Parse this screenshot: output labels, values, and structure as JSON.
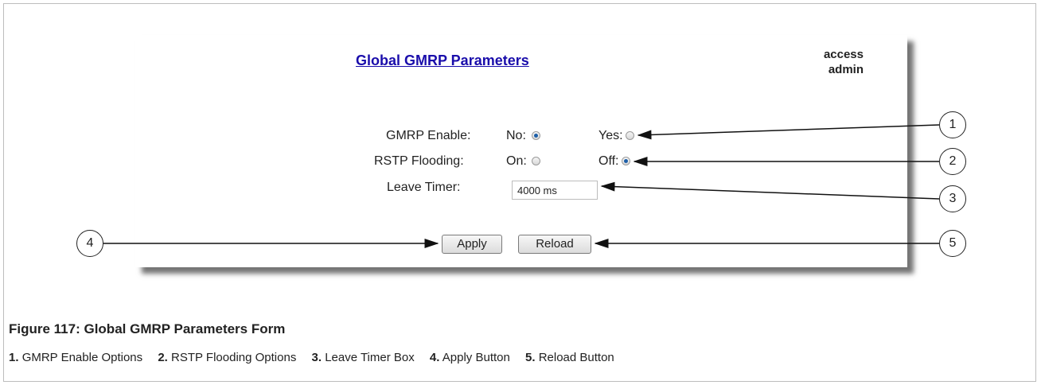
{
  "form": {
    "title": "Global GMRP Parameters",
    "access_line1": "access",
    "access_line2": "admin",
    "gmrp_label": "GMRP Enable:",
    "gmrp_no": "No:",
    "gmrp_yes": "Yes:",
    "gmrp_value": "No",
    "rstp_label": "RSTP Flooding:",
    "rstp_on": "On:",
    "rstp_off": "Off:",
    "rstp_value": "Off",
    "leave_label": "Leave Timer:",
    "leave_value": "4000 ms",
    "apply_label": "Apply",
    "reload_label": "Reload"
  },
  "callouts": [
    "1",
    "2",
    "3",
    "4",
    "5"
  ],
  "caption": "Figure 117: Global GMRP Parameters Form",
  "legend": [
    {
      "num": "1.",
      "text": "GMRP Enable Options"
    },
    {
      "num": "2.",
      "text": "RSTP Flooding Options"
    },
    {
      "num": "3.",
      "text": "Leave Timer Box"
    },
    {
      "num": "4.",
      "text": "Apply Button"
    },
    {
      "num": "5.",
      "text": "Reload Button"
    }
  ]
}
